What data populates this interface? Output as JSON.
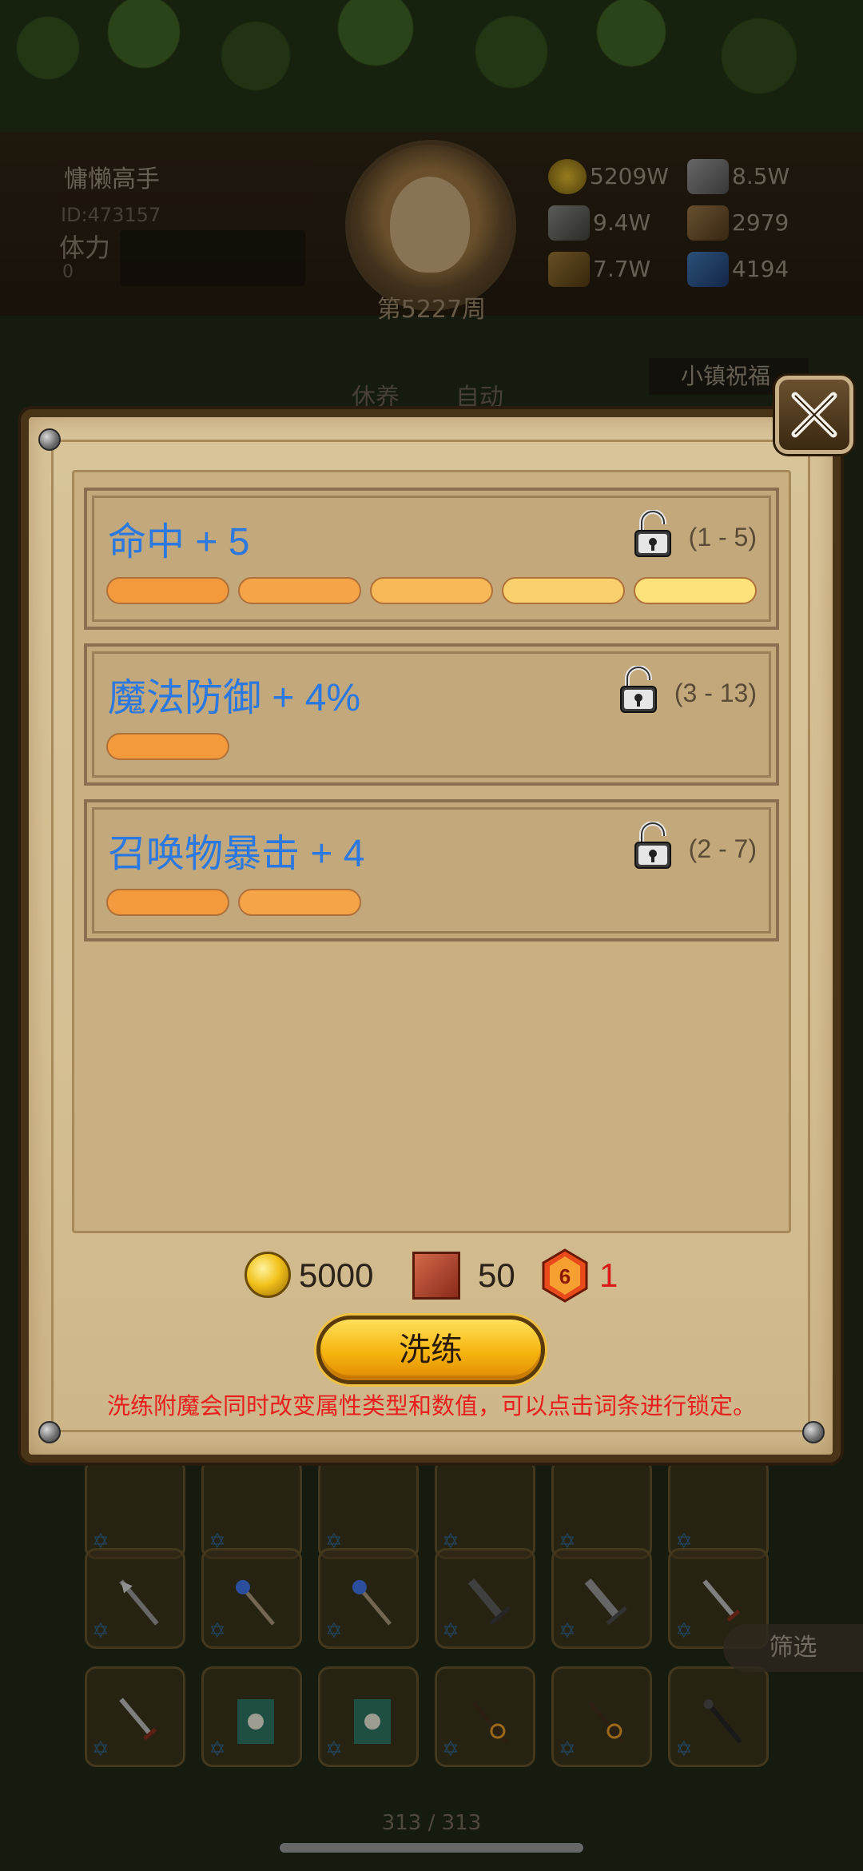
{
  "hud": {
    "player_name": "慵懒高手",
    "player_id": "ID:473157",
    "stamina_label": "体力",
    "stamina_value": "0",
    "week_label": "第5227周",
    "resources": [
      {
        "icon": "gold-coin-icon",
        "value": "5209W"
      },
      {
        "icon": "iron-ingot-icon",
        "value": "8.5W"
      },
      {
        "icon": "stone-ore-icon",
        "value": "9.4W"
      },
      {
        "icon": "parchment-icon",
        "value": "2979"
      },
      {
        "icon": "wood-log-icon",
        "value": "7.7W"
      },
      {
        "icon": "crystal-icon",
        "value": "4194"
      }
    ],
    "menu": {
      "rest_label": "休养",
      "auto_label": "自动"
    },
    "town_blessing_label": "小镇祝福"
  },
  "reforge": {
    "attributes": [
      {
        "name": "命中 + 5",
        "range": "(1 - 5)",
        "level": 5,
        "max_level": 5,
        "locked": false
      },
      {
        "name": "魔法防御 + 4%",
        "range": "(3 - 13)",
        "level": 1,
        "max_level": 5,
        "locked": false
      },
      {
        "name": "召唤物暴击 + 4",
        "range": "(2 - 7)",
        "level": 2,
        "max_level": 5,
        "locked": false
      }
    ],
    "cost": {
      "gold": "5000",
      "scroll": "50",
      "gem": "1",
      "gem_glyph": "6"
    },
    "refine_button_label": "洗练",
    "hint": "洗练附魔会同时改变属性类型和数值，可以点击词条进行锁定。"
  },
  "inventory": {
    "filter_label": "筛选",
    "page_counter": "313 / 313"
  },
  "colors": {
    "attribute_text": "#2a78e0",
    "hint_text": "#e81e1e",
    "bar_shades": [
      "#f39a3c",
      "#f6a448",
      "#f7b858",
      "#fad06c",
      "#fde27c"
    ]
  }
}
